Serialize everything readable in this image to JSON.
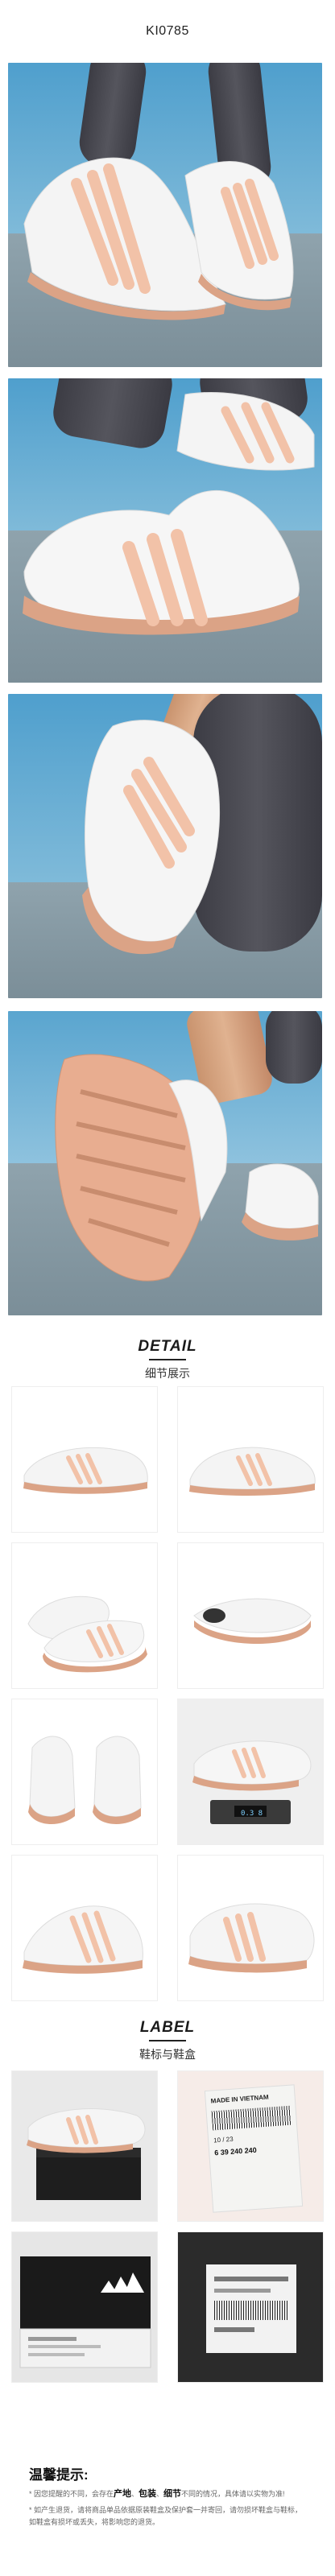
{
  "header": {
    "sku": "KI0785"
  },
  "detail_section": {
    "title_en": "DETAIL",
    "title_zh": "细节展示"
  },
  "label_section": {
    "title_en": "LABEL",
    "title_zh": "鞋标与鞋盒"
  },
  "label_tag": {
    "made_in": "MADE IN VIETNAM",
    "sizes": "6  39 240 240",
    "date": "10 / 23"
  },
  "scale_readout": "0.3 8",
  "tips": {
    "title": "温馨提示:",
    "line1_prefix": "* 因您提醒的不同，会存在",
    "line1_bold_1": "产地",
    "line1_sep_1": "、",
    "line1_bold_2": "包装",
    "line1_sep_2": "、",
    "line1_bold_3": "细节",
    "line1_suffix": "不同的情况，具体请以实物为准!",
    "line2": "* 如产生退货，请将商品单品依据原装鞋盒及保护套一并寄回，请勿损坏鞋盒与鞋标，",
    "line3": "如鞋盒有损坏或丢失，将影响您的退货。"
  },
  "colors": {
    "sky_blue": "#5aa5cf",
    "floor_gray": "#8396a0",
    "shoe_white": "#f4f4f4",
    "stripe_pink": "#f2c2a8",
    "sole_tan": "#dba386"
  }
}
